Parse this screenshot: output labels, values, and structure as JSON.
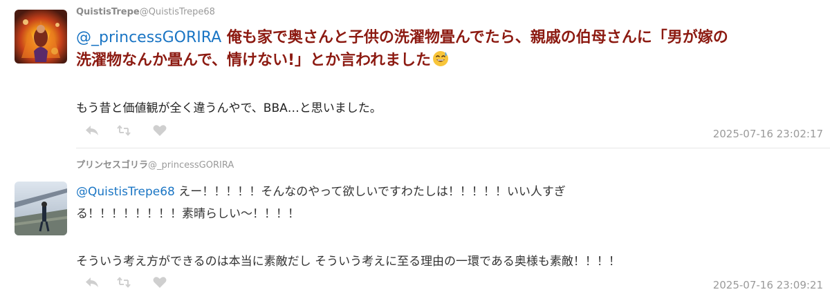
{
  "tweets": [
    {
      "display_name": "QuistisTrepe",
      "handle": "@QuistisTrepe68",
      "mention": "@_princessGORIRA",
      "line1_rest": " 俺も家で奥さんと子供の洗濯物畳んでたら、親戚の伯母さんに「男が嫁の",
      "line2": "洗濯物なんか畳んで、情けない!」とか言われました",
      "emoji": "sweat-smile-emoji",
      "line3": "もう昔と価値観が全く違うんやで、BBA…と思いました。",
      "timestamp": "2025-07-16 23:02:17"
    },
    {
      "display_name": "プリンセスゴリラ",
      "handle": "@_princessGORIRA",
      "mention": "@QuistisTrepe68",
      "line1_rest": " えー！！！！！そんなのやって欲しいですわたしは！！！！！いい人すぎ",
      "line2": "る！！！！！！！！素晴らしい〜！！！！",
      "line3": "そういう考え方ができるのは本当に素敵だし そういう考えに至る理由の一環である奥様も素敵！！！！",
      "timestamp": "2025-07-16 23:09:21"
    }
  ],
  "icons": {
    "reply": "reply-icon",
    "retweet": "retweet-icon",
    "like": "heart-icon"
  },
  "colors": {
    "mention": "#1a75c4",
    "emphasis_text": "#8c1a11",
    "muted": "#9a9a9a",
    "action_icon": "#cfcfcf"
  }
}
